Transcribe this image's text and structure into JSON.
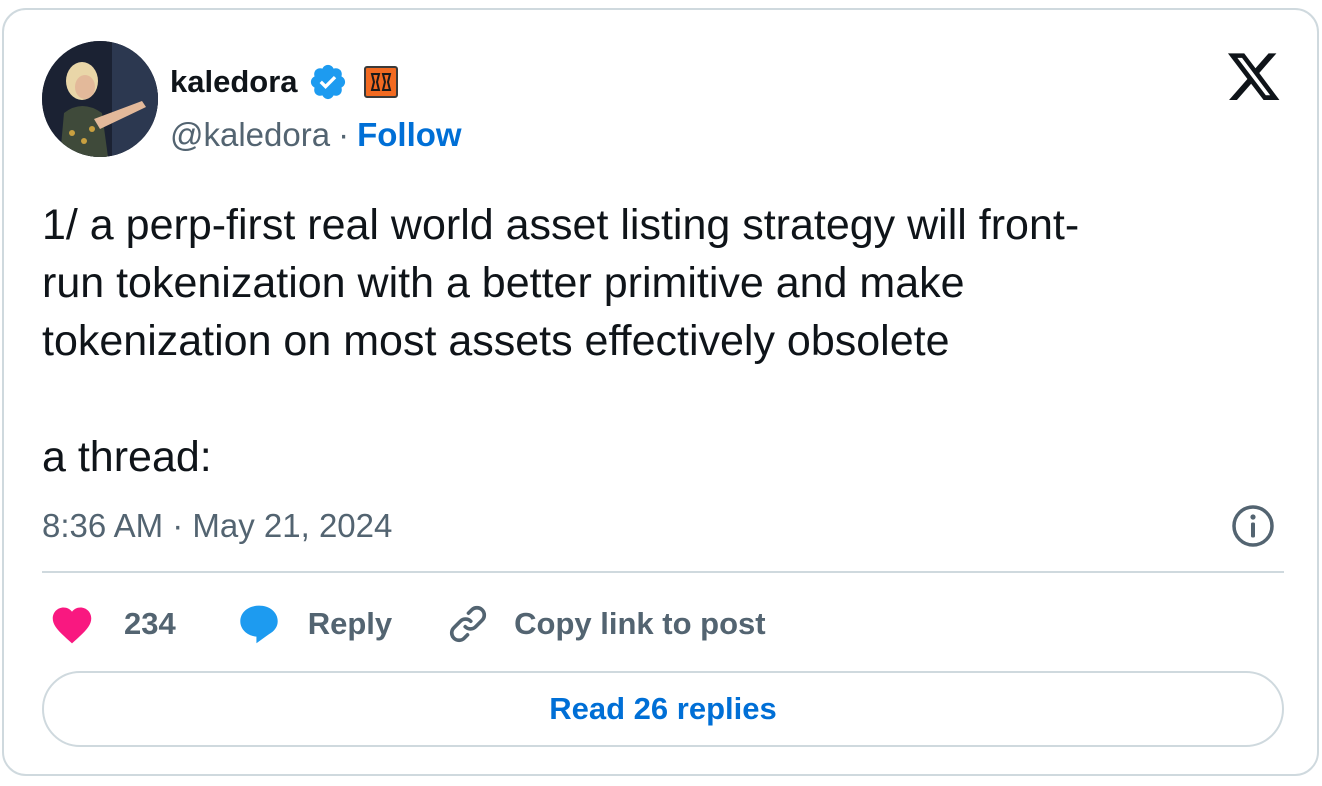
{
  "author": {
    "display_name": "kaledora",
    "handle": "@kaledora",
    "verified": true,
    "separator": "·",
    "follow_label": "Follow",
    "affiliate_badge_color": "#f26a21"
  },
  "tweet": {
    "text": "1/ a perp-first real world asset listing strategy will front-\nrun tokenization with a better primitive and make\ntokenization on most assets effectively obsolete\n\na thread:",
    "timestamp": "8:36 AM · May 21, 2024"
  },
  "actions": {
    "like_count": "234",
    "reply_label": "Reply",
    "copy_label": "Copy link to post"
  },
  "read_replies_label": "Read 26 replies",
  "colors": {
    "accent": "#006fd6",
    "verified": "#1d9bf0",
    "heart": "#f91880",
    "bubble": "#1d9bf0",
    "muted": "#536471",
    "text": "#0f1419",
    "border": "#cfd9de"
  },
  "icons": [
    "verified-badge-icon",
    "affiliate-badge-icon",
    "x-logo-icon",
    "info-icon",
    "heart-icon",
    "reply-bubble-icon",
    "link-icon"
  ]
}
